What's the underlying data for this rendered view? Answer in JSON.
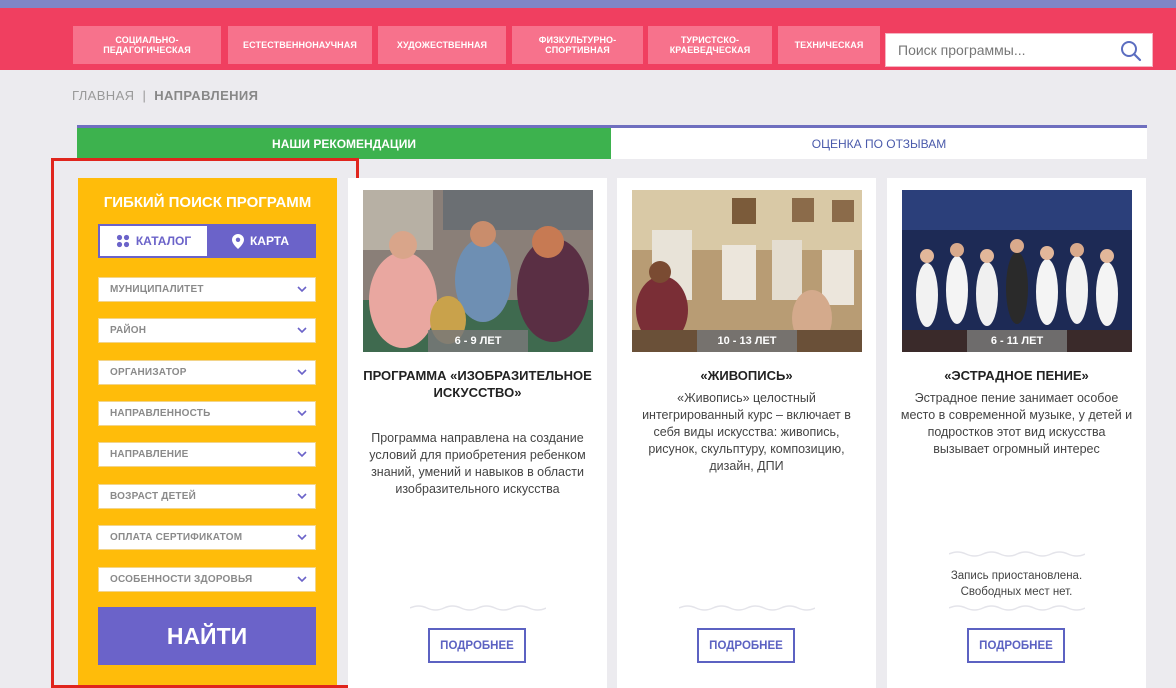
{
  "nav": {
    "categories": [
      "Социально-\nпедагогическая",
      "Естественнонаучная",
      "Художественная",
      "Физкультурно-\nспортивная",
      "Туристско-\nкраеведческая",
      "Техническая"
    ],
    "search_placeholder": "Поиск программы..."
  },
  "breadcrumb": {
    "home": "ГЛАВНАЯ",
    "separator": "|",
    "current": "НАПРАВЛЕНИЯ"
  },
  "tabs": {
    "active": "НАШИ РЕКОМЕНДАЦИИ",
    "inactive": "ОЦЕНКА ПО ОТЗЫВАМ"
  },
  "sidebar": {
    "title": "ГИБКИЙ ПОИСК ПРОГРАММ",
    "catalog_label": "КАТАЛОГ",
    "map_label": "КАРТА",
    "filters": [
      "МУНИЦИПАЛИТЕТ",
      "РАЙОН",
      "ОРГАНИЗАТОР",
      "НАПРАВЛЕННОСТЬ",
      "НАПРАВЛЕНИЕ",
      "ВОЗРАСТ ДЕТЕЙ",
      "ОПЛАТА СЕРТИФИКАТОМ",
      "ОСОБЕННОСТИ ЗДОРОВЬЯ"
    ],
    "find_label": "НАЙТИ"
  },
  "cards": [
    {
      "age": "6 - 9 ЛЕТ",
      "title": "ПРОГРАММА «ИЗОБРАЗИТЕЛЬНОЕ ИСКУССТВО»",
      "description": "Программа направлена на создание условий для приобретения ребенком знаний, умений и навыков в области изобразительного искусства",
      "more_label": "ПОДРОБНЕЕ"
    },
    {
      "age": "10 - 13 ЛЕТ",
      "title": "«ЖИВОПИСЬ»",
      "description": "«Живопись» целостный интегрированный курс – включает в себя виды искусства: живопись, рисунок, скульптуру, композицию, дизайн, ДПИ",
      "more_label": "ПОДРОБНЕЕ"
    },
    {
      "age": "6 - 11 ЛЕТ",
      "title": "«ЭСТРАДНОЕ ПЕНИЕ»",
      "description": "Эстрадное пение занимает особое место в современной музыке, у детей и подростков этот вид искусства вызывает огромный интерес",
      "status": "Запись приостановлена.\nСвободных мест нет.",
      "more_label": "ПОДРОБНЕЕ"
    }
  ],
  "colors": {
    "nav_bg": "#f03f60",
    "nav_button": "#f7728c",
    "accent_purple": "#6b63c9",
    "sidebar_yellow": "#ffbc0a",
    "tab_green": "#3db24e",
    "highlight_red": "#e0251d"
  }
}
